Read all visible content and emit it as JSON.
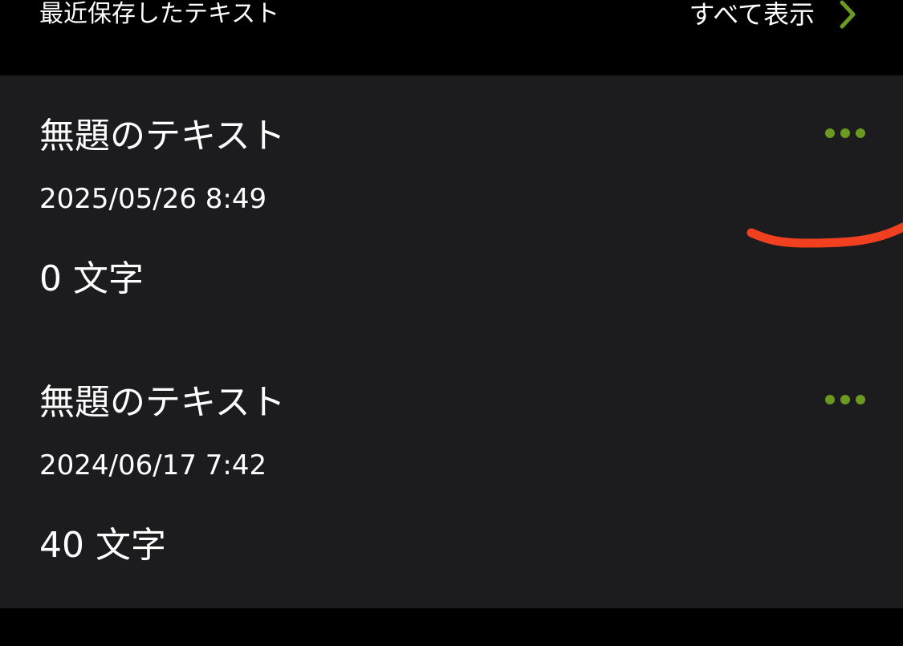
{
  "header": {
    "title": "最近保存したテキスト",
    "show_all_label": "すべて表示",
    "chevron_icon": "chevron-right-icon"
  },
  "items": [
    {
      "title": "無題のテキスト",
      "date": "2025/05/26 8:49",
      "count": "0 文字",
      "menu_icon": "more-ellipsis-icon"
    },
    {
      "title": "無題のテキスト",
      "date": "2024/06/17 7:42",
      "count": "40 文字",
      "menu_icon": "more-ellipsis-icon"
    }
  ],
  "colors": {
    "background": "#000000",
    "list_background": "#1c1c1e",
    "text": "#ffffff",
    "accent": "#6a9a1f",
    "annotation": "#f04020"
  }
}
